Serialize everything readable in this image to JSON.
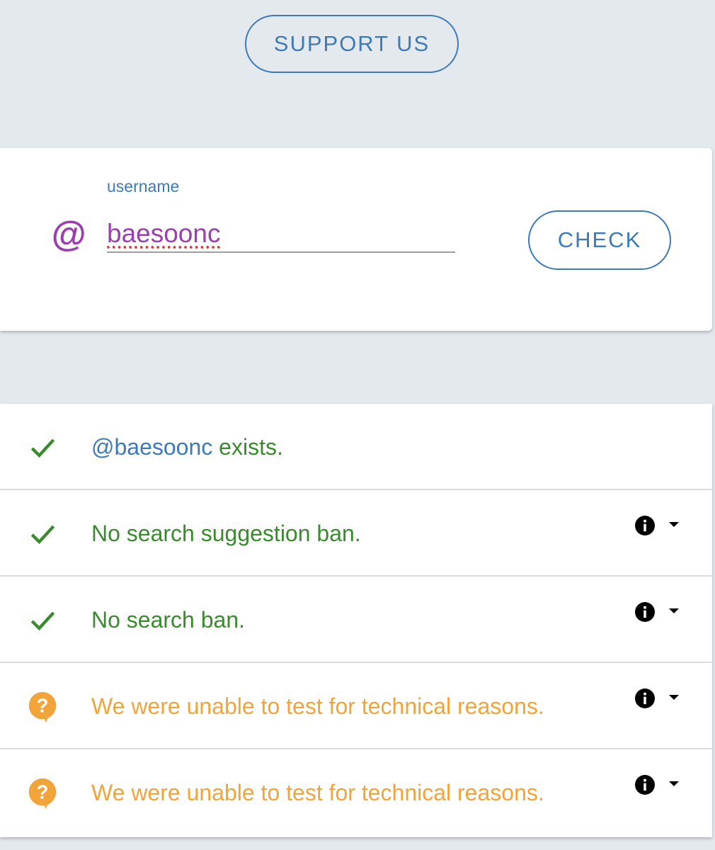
{
  "header": {
    "support_label": "SUPPORT US"
  },
  "form": {
    "label": "username",
    "at_symbol": "@",
    "username_value": "baesoonc",
    "check_label": "CHECK"
  },
  "results": [
    {
      "status": "ok",
      "icon": "checkmark-icon",
      "handle": "@baesoonc",
      "text": " exists.",
      "has_info": false
    },
    {
      "status": "ok",
      "icon": "checkmark-icon",
      "text": "No search suggestion ban.",
      "has_info": true
    },
    {
      "status": "ok",
      "icon": "checkmark-icon",
      "text": "No search ban.",
      "has_info": true
    },
    {
      "status": "unknown",
      "icon": "question-bubble-icon",
      "text": "We were unable to test for technical reasons.",
      "has_info": true
    },
    {
      "status": "unknown",
      "icon": "question-bubble-icon",
      "text": "We were unable to test for technical reasons.",
      "has_info": true
    }
  ],
  "colors": {
    "accent_blue": "#3d7ab8",
    "username_purple": "#9b3fae",
    "ok_green": "#3a8a2e",
    "warning_orange": "#f0a43a",
    "background": "#e4e9ee"
  }
}
